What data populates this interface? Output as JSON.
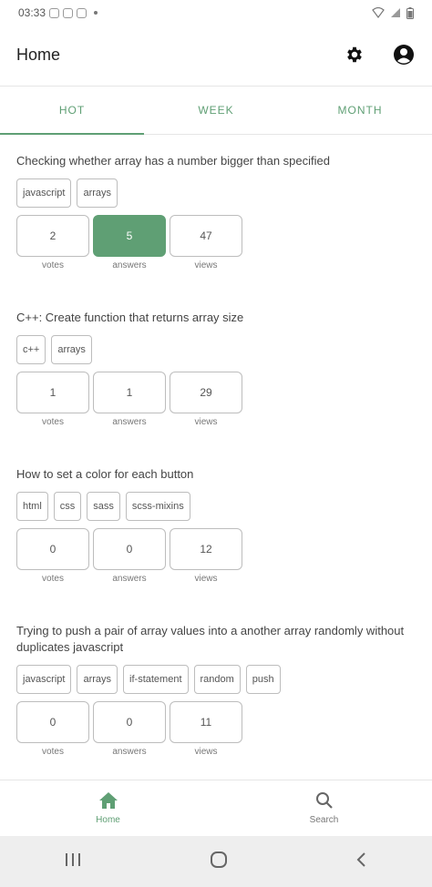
{
  "status_bar": {
    "time": "03:33"
  },
  "app_bar": {
    "title": "Home"
  },
  "tabs": [
    {
      "label": "HOT",
      "active": true
    },
    {
      "label": "WEEK",
      "active": false
    },
    {
      "label": "MONTH",
      "active": false
    }
  ],
  "questions": [
    {
      "title": "Checking whether array has a number bigger than specified",
      "tags": [
        "javascript",
        "arrays"
      ],
      "votes": "2",
      "answers": "5",
      "views": "47",
      "answers_accepted": true
    },
    {
      "title": "C++: Create function that returns array size",
      "tags": [
        "c++",
        "arrays"
      ],
      "votes": "1",
      "answers": "1",
      "views": "29",
      "answers_accepted": false
    },
    {
      "title": "How to set a color for each button",
      "tags": [
        "html",
        "css",
        "sass",
        "scss-mixins"
      ],
      "votes": "0",
      "answers": "0",
      "views": "12",
      "answers_accepted": false
    },
    {
      "title": "Trying to push a pair of array values into a another array randomly without duplicates javascript",
      "tags": [
        "javascript",
        "arrays",
        "if-statement",
        "random",
        "push"
      ],
      "votes": "0",
      "answers": "0",
      "views": "11",
      "answers_accepted": false
    }
  ],
  "stat_labels": {
    "votes": "votes",
    "answers": "answers",
    "views": "views"
  },
  "bottom_nav": [
    {
      "label": "Home",
      "icon": "home-icon",
      "active": true
    },
    {
      "label": "Search",
      "icon": "search-icon",
      "active": false
    }
  ],
  "colors": {
    "accent": "#5f9f74"
  }
}
